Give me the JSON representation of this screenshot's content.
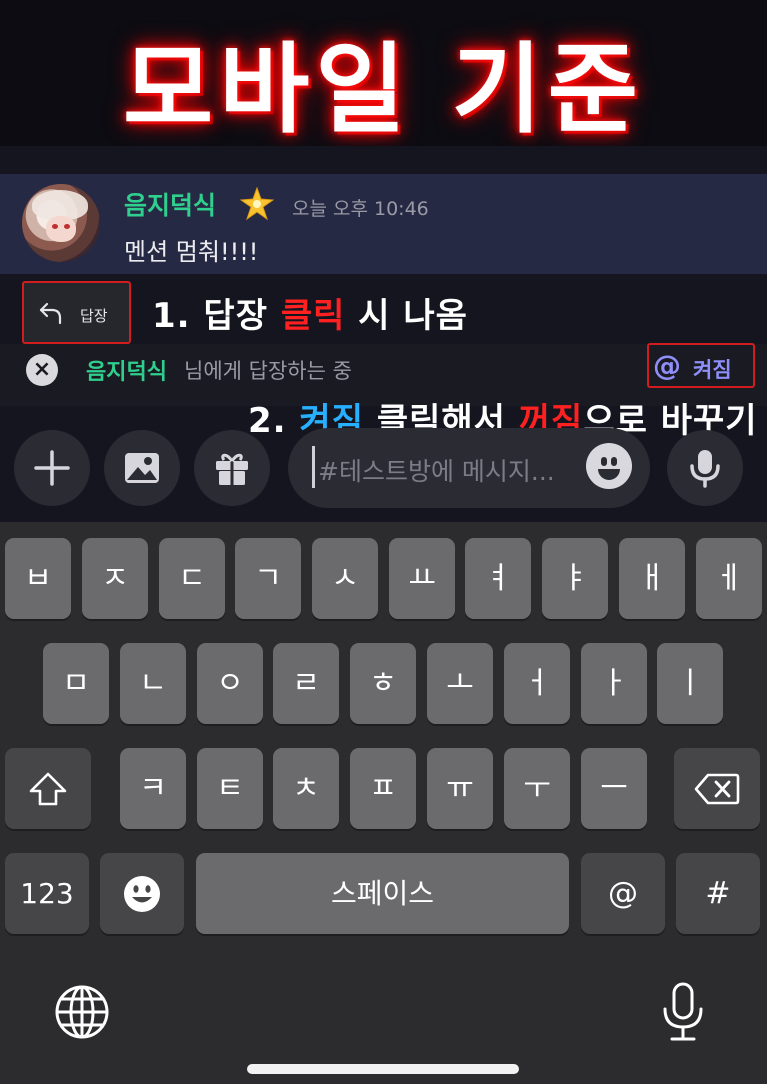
{
  "banner": {
    "title": "모바일 기준"
  },
  "message": {
    "username": "음지덕식",
    "timestamp": "오늘 오후 10:46",
    "text": "멘션 멈춰!!!!"
  },
  "reply_action": {
    "label": "답장"
  },
  "annotations": {
    "step1_prefix": "1. 답장 ",
    "step1_highlight": "클릭",
    "step1_suffix": " 시 나옴",
    "step2_prefix": "2. ",
    "step2_on": "켜짐",
    "step2_middle": " 클릭해서 ",
    "step2_off": "꺼짐",
    "step2_suffix": "으로 바꾸기"
  },
  "reply_bar": {
    "close_glyph": "×",
    "target_name": "음지덕식",
    "suffix": " 님에게 답장하는 중",
    "mention_symbol": "@",
    "mention_state": "켜짐"
  },
  "composer": {
    "placeholder": "#테스트방에 메시지..."
  },
  "keyboard": {
    "row1": [
      "ㅂ",
      "ㅈ",
      "ㄷ",
      "ㄱ",
      "ㅅ",
      "ㅛ",
      "ㅕ",
      "ㅑ",
      "ㅐ",
      "ㅔ"
    ],
    "row2": [
      "ㅁ",
      "ㄴ",
      "ㅇ",
      "ㄹ",
      "ㅎ",
      "ㅗ",
      "ㅓ",
      "ㅏ",
      "ㅣ"
    ],
    "row3": [
      "ㅋ",
      "ㅌ",
      "ㅊ",
      "ㅍ",
      "ㅠ",
      "ㅜ",
      "ㅡ"
    ],
    "numbers_label": "123",
    "space_label": "스페이스",
    "at_label": "@",
    "hash_label": "#"
  },
  "colors": {
    "username_green": "#2fcf8e",
    "mention_purple": "#8e8ff8",
    "highlight_red": "#d11d1d",
    "annotation_blue": "#27b0ff"
  }
}
